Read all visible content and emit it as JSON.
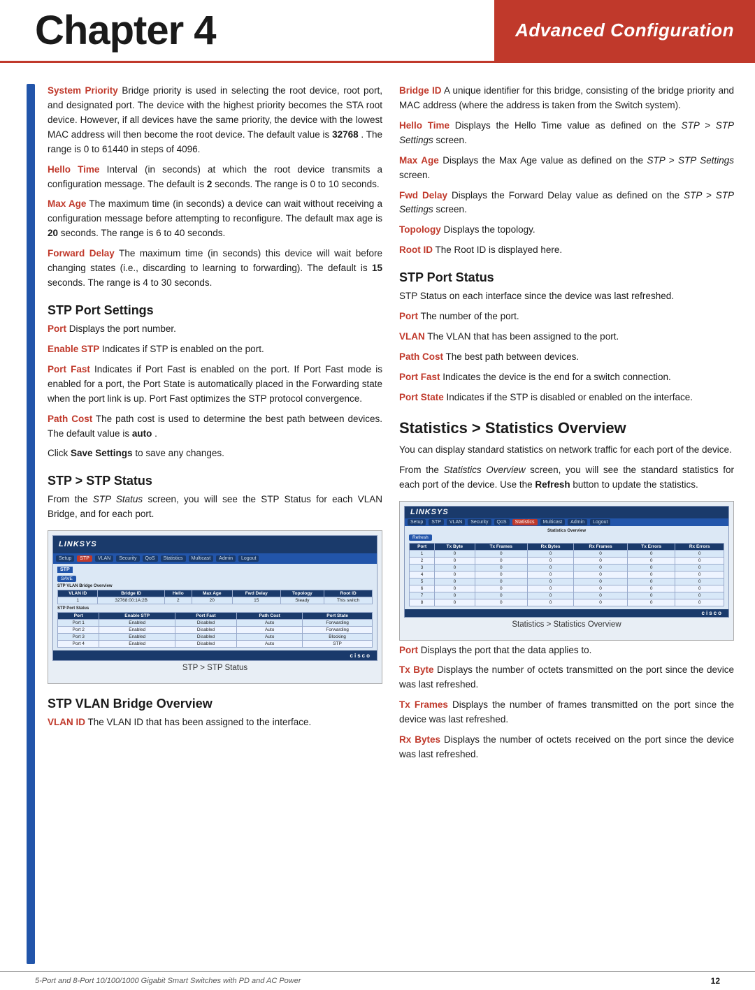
{
  "header": {
    "chapter_label": "Chapter 4",
    "title": "Advanced Configuration"
  },
  "footer": {
    "product_label": "5-Port and 8-Port 10/100/1000 Gigabit Smart Switches with PD and AC Power",
    "page_number": "12"
  },
  "col_left": {
    "paragraphs": [
      {
        "term": "System Priority",
        "term_style": "red-bold",
        "text": " Bridge priority is used in selecting the root device, root port, and designated port. The device with the highest priority becomes the STA root device. However, if all devices have the same priority, the device with the lowest MAC address will then become the root device. The default value is ",
        "bold_inline": "32768",
        "text2": ". The range is 0 to 61440 in steps of 4096."
      },
      {
        "term": "Hello Time",
        "term_style": "red-bold",
        "text": " Interval (in seconds) at which the root device transmits a configuration message. The default is ",
        "bold_inline": "2",
        "text2": " seconds. The range is 0 to 10 seconds."
      },
      {
        "term": "Max Age",
        "term_style": "red-bold",
        "text": " The maximum time (in seconds) a device can wait without receiving a configuration message before attempting to reconfigure. The default max age is ",
        "bold_inline": "20",
        "text2": " seconds. The range is 6 to 40 seconds."
      },
      {
        "term": "Forward Delay",
        "term_style": "red-bold",
        "text": " The maximum time (in seconds) this device will wait before changing states (i.e., discarding to learning to forwarding). The default is ",
        "bold_inline": "15",
        "text2": " seconds. The range is 4 to 30 seconds."
      }
    ],
    "stp_port_settings": {
      "heading": "STP Port Settings",
      "items": [
        {
          "term": "Port",
          "text": "  Displays the port number."
        },
        {
          "term": "Enable STP",
          "text": "  Indicates if STP is enabled on the port."
        },
        {
          "term": "Port Fast",
          "text": "  Indicates if Port Fast is enabled on the port. If Port Fast mode is enabled for a port, the Port State is automatically placed in the Forwarding state when the port link is up. Port Fast optimizes the STP protocol convergence."
        },
        {
          "term": "Path Cost",
          "text": " The path cost is used to determine the best path between devices. The default value is ",
          "bold_inline": "auto",
          "text2": "."
        },
        {
          "term_plain": "Click ",
          "bold_inline": "Save Settings",
          "text": " to save any changes."
        }
      ]
    },
    "stp_status": {
      "heading": "STP > STP Status",
      "intro": "From the STP Status screen, you will see the STP Status for each VLAN Bridge, and for each port.",
      "caption": "STP > STP Status"
    },
    "stp_vlan": {
      "heading": "STP VLAN Bridge Overview",
      "items": [
        {
          "term": "VLAN ID",
          "text": "  The VLAN ID that has been assigned to the interface."
        }
      ]
    }
  },
  "col_right": {
    "items": [
      {
        "term": "Bridge ID",
        "text": "  A unique identifier for this bridge, consisting of the bridge priority and MAC address (where the address is taken from the Switch system)."
      },
      {
        "term": "Hello Time",
        "text": "  Displays the Hello Time value as defined on the ",
        "italic": "STP > STP Settings",
        "text2": " screen."
      },
      {
        "term": "Max Age",
        "text": "  Displays the Max Age value as defined on the ",
        "italic": "STP > STP Settings",
        "text2": " screen."
      },
      {
        "term": "Fwd Delay",
        "text": "  Displays the Forward Delay value as defined on the ",
        "italic": "STP > STP Settings",
        "text2": " screen."
      },
      {
        "term": "Topology",
        "text": "  Displays the topology."
      },
      {
        "term": "Root ID",
        "text": "  The Root ID is displayed here."
      }
    ],
    "stp_port_status": {
      "heading": "STP Port Status",
      "intro": "STP Status on each interface since the device was last refreshed.",
      "items": [
        {
          "term": "Port",
          "text": "  The number of the port."
        },
        {
          "term": "VLAN",
          "text": "  The VLAN that has been assigned to the port."
        },
        {
          "term": "Path Cost",
          "text": "  The best path between devices."
        },
        {
          "term": "Port Fast",
          "text": "  Indicates the device is the end for a switch connection."
        },
        {
          "term": "Port State",
          "text": "  Indicates if the STP is disabled or enabled on the interface."
        }
      ]
    },
    "statistics": {
      "heading": "Statistics > Statistics Overview",
      "intro": "You can display standard statistics on network traffic for each port of the device.",
      "detail": "From the Statistics Overview screen, you will see the standard statistics for each port of the device. Use the Refresh button to update the statistics.",
      "caption": "Statistics > Statistics Overview",
      "items": [
        {
          "term": "Port",
          "text": "  Displays the port that the data applies to."
        },
        {
          "term": "Tx Byte",
          "text": "  Displays the number of octets transmitted on the port since the device was last refreshed."
        },
        {
          "term": "Tx Frames",
          "text": "  Displays the number of frames transmitted on the port since the device was last refreshed."
        },
        {
          "term": "Rx Bytes",
          "text": "  Displays the number of octets received on the port since the device was last refreshed."
        }
      ]
    }
  }
}
